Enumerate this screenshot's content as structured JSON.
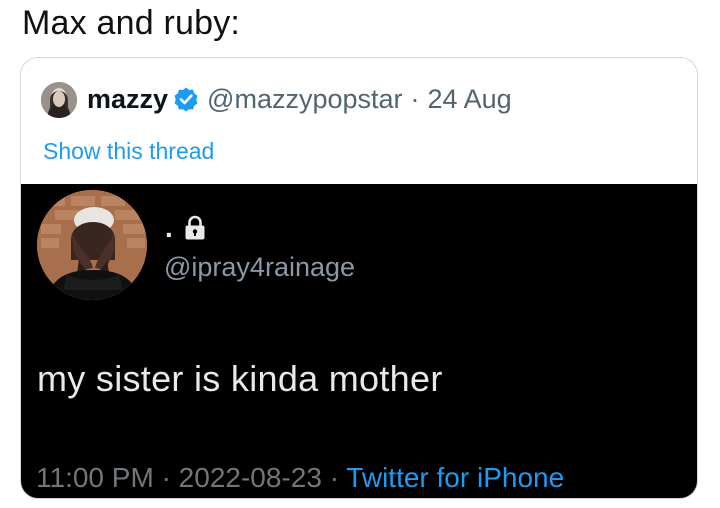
{
  "caption": "Max and ruby:",
  "quoted_tweet": {
    "display_name": "mazzy",
    "handle": "@mazzypopstar",
    "separator": "·",
    "date": "24 Aug",
    "show_thread_label": "Show this thread"
  },
  "inner_tweet": {
    "display_name": ".",
    "handle": "@ipray4rainage",
    "text": "my sister is kinda mother",
    "time": "11:00 PM",
    "separator_1": "·",
    "date": "2022-08-23",
    "separator_2": "·",
    "source": "Twitter for iPhone"
  },
  "icons": {
    "verified": "verified-badge-icon",
    "lock": "lock-icon"
  },
  "colors": {
    "link_blue": "#1d9bf0",
    "dark_background": "#000000",
    "muted_text": "#536471"
  }
}
